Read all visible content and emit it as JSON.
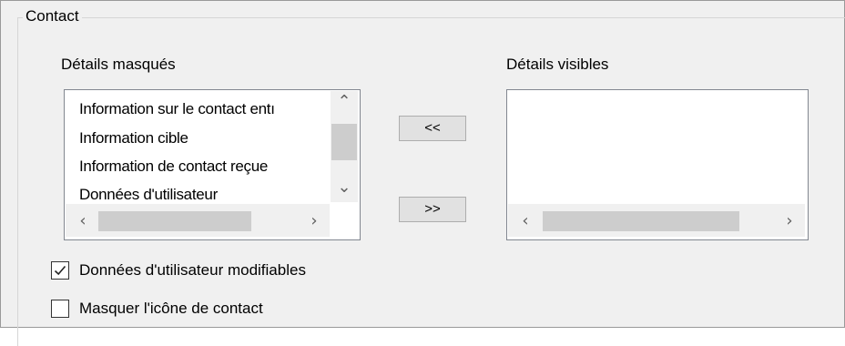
{
  "group": {
    "title": "Contact"
  },
  "hidden_details": {
    "label": "Détails masqués",
    "items": [
      "Information sur le contact entı",
      "Information cible",
      "Information de contact reçue",
      "Données d'utilisateur"
    ]
  },
  "visible_details": {
    "label": "Détails visibles",
    "items": []
  },
  "buttons": {
    "move_left": "<<",
    "move_right": ">>"
  },
  "checkboxes": {
    "editable_user_data": {
      "label": "Données d'utilisateur modifiables",
      "checked": true
    },
    "hide_contact_icon": {
      "label": "Masquer l'icône de contact",
      "checked": false
    }
  }
}
